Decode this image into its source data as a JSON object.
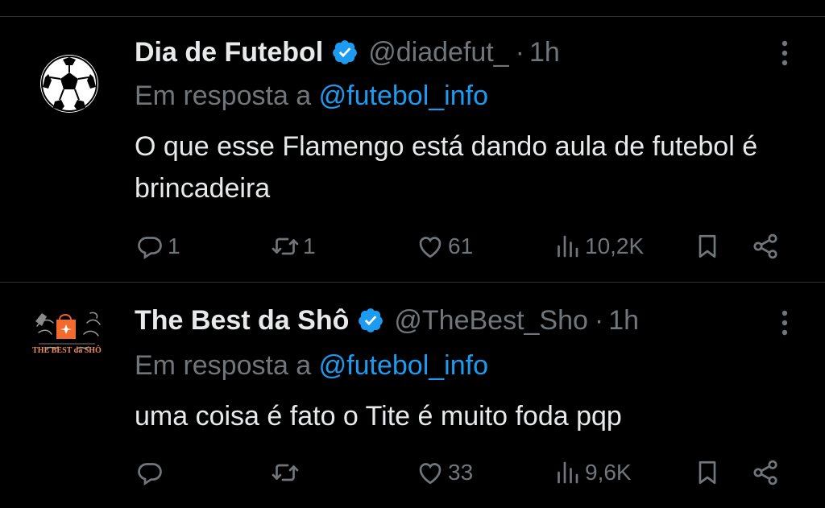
{
  "tweets": [
    {
      "name": "Dia de Futebol",
      "handle": "@diadefut_",
      "separator": "·",
      "time": "1h",
      "reply_prefix": "Em resposta a",
      "reply_to": "@futebol_info",
      "text": "O que esse Flamengo está dando aula de futebol é brincadeira",
      "replies": "1",
      "retweets": "1",
      "likes": "61",
      "views": "10,2K",
      "avatar": "soccer-ball"
    },
    {
      "name": "The Best da Shô",
      "handle": "@TheBest_Sho",
      "separator": "·",
      "time": "1h",
      "reply_prefix": "Em resposta a",
      "reply_to": "@futebol_info",
      "text": "uma coisa é fato o Tite é muito foda pqp",
      "replies": "",
      "retweets": "",
      "likes": "33",
      "views": "9,6K",
      "avatar": "the-best-da-sho-logo",
      "avatar_logo_text": "THE BEST da SHÔ"
    }
  ],
  "colors": {
    "background": "#000000",
    "text": "#e7e9ea",
    "muted": "#71767b",
    "link": "#1d9bf0",
    "verified": "#1d9bf0",
    "divider": "#2f3336"
  },
  "icons": [
    "verified-badge-icon",
    "more-icon",
    "reply-icon",
    "retweet-icon",
    "like-icon",
    "views-icon",
    "bookmark-icon",
    "share-icon"
  ]
}
